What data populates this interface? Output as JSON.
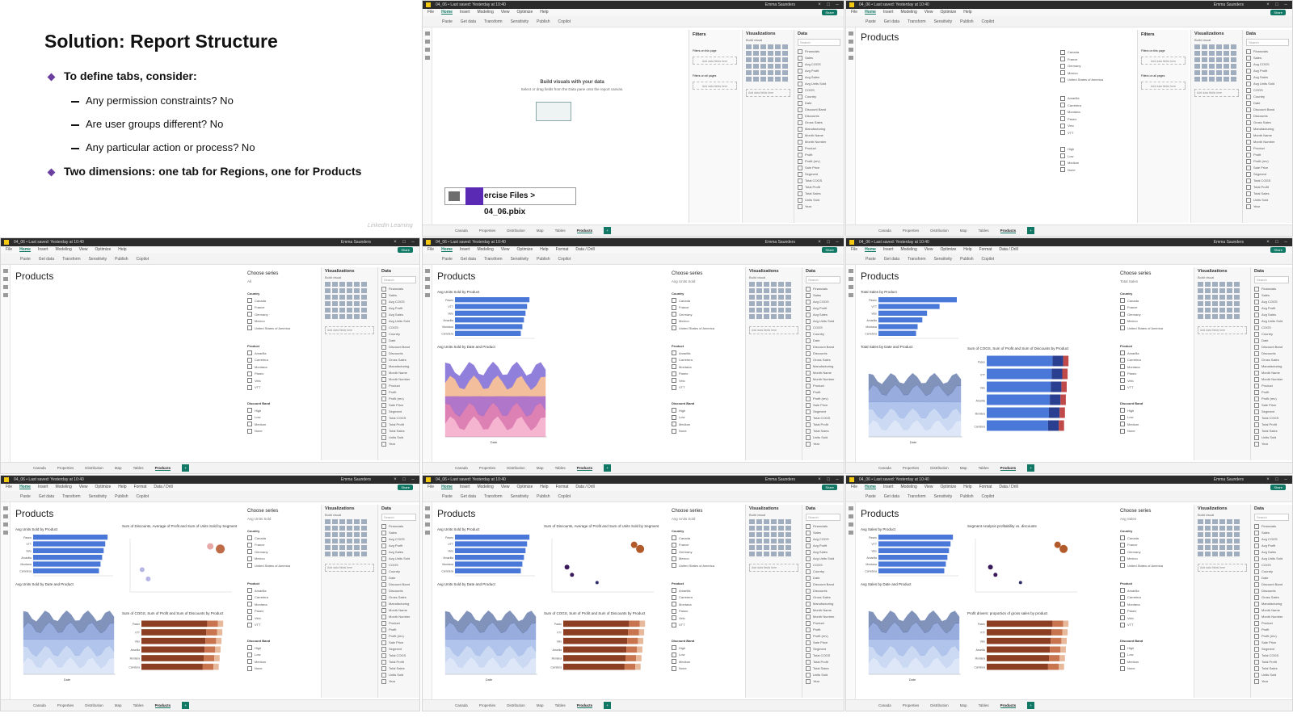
{
  "slide": {
    "title": "Solution: Report Structure",
    "bullets": [
      {
        "text": "To define tabs, consider:",
        "subs": [
          "Any permission constraints? No",
          "Are user groups different? No",
          "Any particular action or process? No"
        ]
      },
      {
        "text": "Two dimensions: one tab for Regions, one for Products",
        "subs": []
      }
    ]
  },
  "app": {
    "title_text": "04_06 • Last saved: Yesterday at 10:40",
    "user": "Emma Saunders",
    "menu": [
      "File",
      "Home",
      "Insert",
      "Modeling",
      "View",
      "Optimize",
      "Help"
    ],
    "menu_extra": [
      "Format",
      "Data / Drill"
    ],
    "active_menu": "Home",
    "share": "Share",
    "ribbon_items": [
      "Paste",
      "Get data",
      "Transform",
      "Sensitivity",
      "Publish",
      "Copilot"
    ],
    "page_tabs": [
      "Canada",
      "Properties",
      "Distribution",
      "Map",
      "Tables",
      "Products"
    ],
    "current_tab": "Products",
    "add_tab": "+",
    "status": "Page 6 of 6",
    "zoom": "70%"
  },
  "panes": {
    "filters": "Filters",
    "visualizations": "Visualizations",
    "data": "Data",
    "build_visual": "Build visual",
    "search": "Search",
    "filters_on_page": "Filters on this page",
    "filters_all_pages": "Filters on all pages",
    "add_fields": "Add data fields here",
    "fields": [
      "Financials",
      "Sales",
      "Avg COGS",
      "Avg Profit",
      "Avg Sales",
      "Avg Units Sold",
      "COGS",
      "Country",
      "Date",
      "Discount Band",
      "Discounts",
      "Gross Sales",
      "Manufacturing",
      "Month Name",
      "Month Number",
      "Product",
      "Profit",
      "Profit (rev)",
      "Sale Price",
      "Segment",
      "Total COGS",
      "Total Profit",
      "Total Sales",
      "Units Sold",
      "Year"
    ]
  },
  "canvas": {
    "empty_title": "Build visuals with your data",
    "empty_sub": "Select or drag fields from the Data pane onto the report canvas.",
    "file_chip": "ercise Files > 04_06.pbix",
    "report_title": "Products",
    "choose_series": "Choose series",
    "series_values": [
      "All",
      "Avg Units Sold",
      "Avg Units Sold",
      "Total Sales",
      "Avg Units Sold",
      "Avg Units Sold",
      "Avg Sales"
    ],
    "slicers": {
      "country_head": "Country",
      "countries": [
        "Canada",
        "France",
        "Germany",
        "Mexico",
        "United States of America"
      ],
      "product_head": "Product",
      "products": [
        "Amarilla",
        "Carretera",
        "Montana",
        "Paseo",
        "Velo",
        "VTT"
      ],
      "band_head": "Discount Band",
      "bands": [
        "High",
        "Low",
        "Medium",
        "None"
      ]
    },
    "visual_titles": {
      "bar_units": "Avg Units Sold by Product",
      "area_units": "Avg Units Sold by Date and Product",
      "bar_sales": "Total Sales by Product",
      "area_sales": "Total Sales by Date and Product",
      "stack": "Sum of COGS, Sum of Profit and Sum of Discounts by Product",
      "scatter": "Sum of Discounts, Average of Profit and Sum of Units Sold by Segment",
      "scatter2": "Segment Analysis profitability vs. discounts",
      "stack2": "Profit drivers: proportion of gross sales by product",
      "bar_sales2": "Avg Sales by Product",
      "area_sales2": "Avg Sales by Date and Product",
      "date_axis": "Date",
      "product_axis": "Product"
    },
    "bar_products": [
      "Paseo",
      "VTT",
      "Velo",
      "Amarilla",
      "Montana",
      "Carretera"
    ],
    "bar_values_units": [
      0.95,
      0.92,
      0.9,
      0.88,
      0.86,
      0.84
    ],
    "bar_values_sales": [
      1.0,
      0.78,
      0.62,
      0.56,
      0.5,
      0.48
    ]
  },
  "colors": {
    "accent": "#117865",
    "bar_blue": "#4a78d8",
    "stack_blue": [
      "#4a78d8",
      "#2a3f8f",
      "#c04a4a"
    ],
    "stack_brown": [
      "#8b3e22",
      "#c7744f",
      "#e8b89b"
    ],
    "slide_bullet": "#6b3fa0",
    "purple_chip": "#5b2ab5"
  },
  "watermark": "LinkedIn Learning"
}
